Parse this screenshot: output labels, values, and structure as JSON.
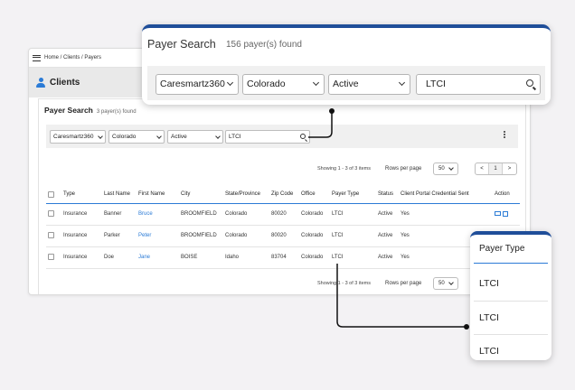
{
  "breadcrumb": "Home / Clients / Payers",
  "section_title": "Clients",
  "panel": {
    "title": "Payer Search",
    "count": "3 payer(s) found",
    "filters": {
      "company": "Caresmartz360",
      "state": "Colorado",
      "status": "Active",
      "search_value": "LTCI"
    }
  },
  "pagination_top": {
    "showing": "Showing 1 - 3 of 3 items",
    "rows_label": "Rows per page",
    "rows_value": "50",
    "prev": "<",
    "page": "1",
    "next": ">"
  },
  "table": {
    "columns": [
      "Type",
      "Last Name",
      "First Name",
      "City",
      "State/Province",
      "Zip Code",
      "Office",
      "Payer Type",
      "Status",
      "Client Portal Credential Sent",
      "Action"
    ],
    "rows": [
      {
        "type": "Insurance",
        "last": "Banner",
        "first": "Bruce",
        "city": "BROOMFIELD",
        "state": "Colorado",
        "zip": "80020",
        "office": "Colorado",
        "payer_type": "LTCI",
        "status": "Active",
        "sent": "Yes"
      },
      {
        "type": "Insurance",
        "last": "Parker",
        "first": "Peter",
        "city": "BROOMFIELD",
        "state": "Colorado",
        "zip": "80020",
        "office": "Colorado",
        "payer_type": "LTCI",
        "status": "Active",
        "sent": "Yes"
      },
      {
        "type": "Insurance",
        "last": "Doe",
        "first": "Jane",
        "city": "BOISE",
        "state": "Idaho",
        "zip": "83704",
        "office": "Colorado",
        "payer_type": "LTCI",
        "status": "Active",
        "sent": "Yes"
      }
    ]
  },
  "pagination_bottom": {
    "showing": "Showing 1 - 3 of 3 items",
    "rows_label": "Rows per page",
    "rows_value": "50"
  },
  "zoom_search": {
    "title": "Payer Search",
    "count": "156 payer(s) found",
    "company": "Caresmartz360",
    "state": "Colorado",
    "status": "Active",
    "search_value": "LTCI"
  },
  "zoom_payer_type": {
    "header": "Payer Type",
    "values": [
      "LTCI",
      "LTCI",
      "LTCI"
    ]
  },
  "colors": {
    "accent": "#2b7bd6",
    "callout_border": "#1f4e99",
    "connector": "#111111"
  }
}
